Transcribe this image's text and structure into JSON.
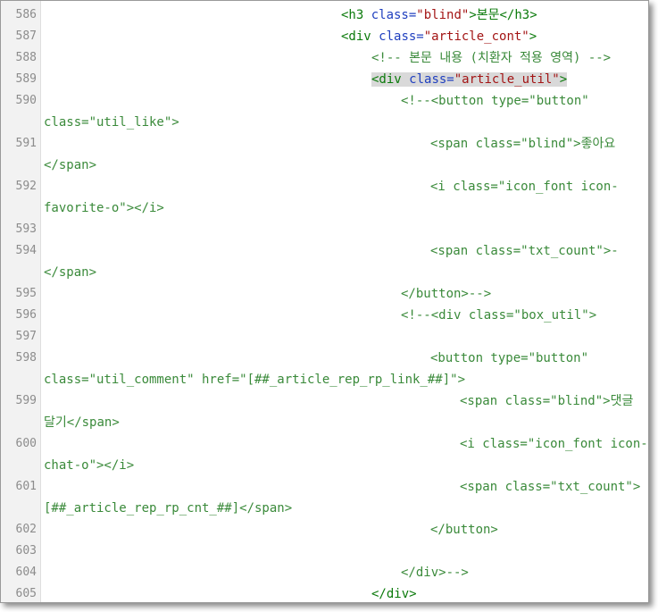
{
  "editor": {
    "lines": [
      {
        "num": "586",
        "segments": [
          "<h3 ",
          "class=",
          "\"blind\"",
          ">본문</h3>"
        ]
      },
      {
        "num": "587",
        "segments": [
          "<div ",
          "class=",
          "\"article_cont\"",
          ">"
        ]
      },
      {
        "num": "588",
        "comment": "<!-- 본문 내용 (치환자 적용 영역) -->"
      },
      {
        "num": "589",
        "segments": [
          "<div ",
          "class=",
          "\"article_util\"",
          ">"
        ]
      },
      {
        "num": "590",
        "comment1": "<!--<button type=\"button\"",
        "comment2": "class=\"util_like\">"
      },
      {
        "num": "591",
        "c1": "<span class=\"blind\">좋아요",
        "c2": "</span>"
      },
      {
        "num": "592",
        "c1": "<i class=\"icon_font icon-",
        "c2": "favorite-o\"></i>"
      },
      {
        "num": "593"
      },
      {
        "num": "594",
        "c1": "<span class=\"txt_count\">-",
        "c2": "</span>"
      },
      {
        "num": "595",
        "c1": "</button>-->"
      },
      {
        "num": "596",
        "c1": "<!--<div class=\"box_util\">"
      },
      {
        "num": "597"
      },
      {
        "num": "598",
        "c1": "<button type=\"button\"",
        "c2": "class=\"util_comment\" href=\"[##_article_rep_rp_link_##]\">"
      },
      {
        "num": "599",
        "c1": "<span class=\"blind\">댓글",
        "c2": "달기</span>"
      },
      {
        "num": "600",
        "c1": "<i class=\"icon_font icon-",
        "c2": "chat-o\"></i>"
      },
      {
        "num": "601",
        "c1": "<span class=\"txt_count\">",
        "c2": "[##_article_rep_rp_cnt_##]</span>"
      },
      {
        "num": "602",
        "c1": "</button>"
      },
      {
        "num": "603"
      },
      {
        "num": "604",
        "c1": "</div>-->"
      },
      {
        "num": "605",
        "segments": [
          "</div>"
        ]
      }
    ]
  }
}
